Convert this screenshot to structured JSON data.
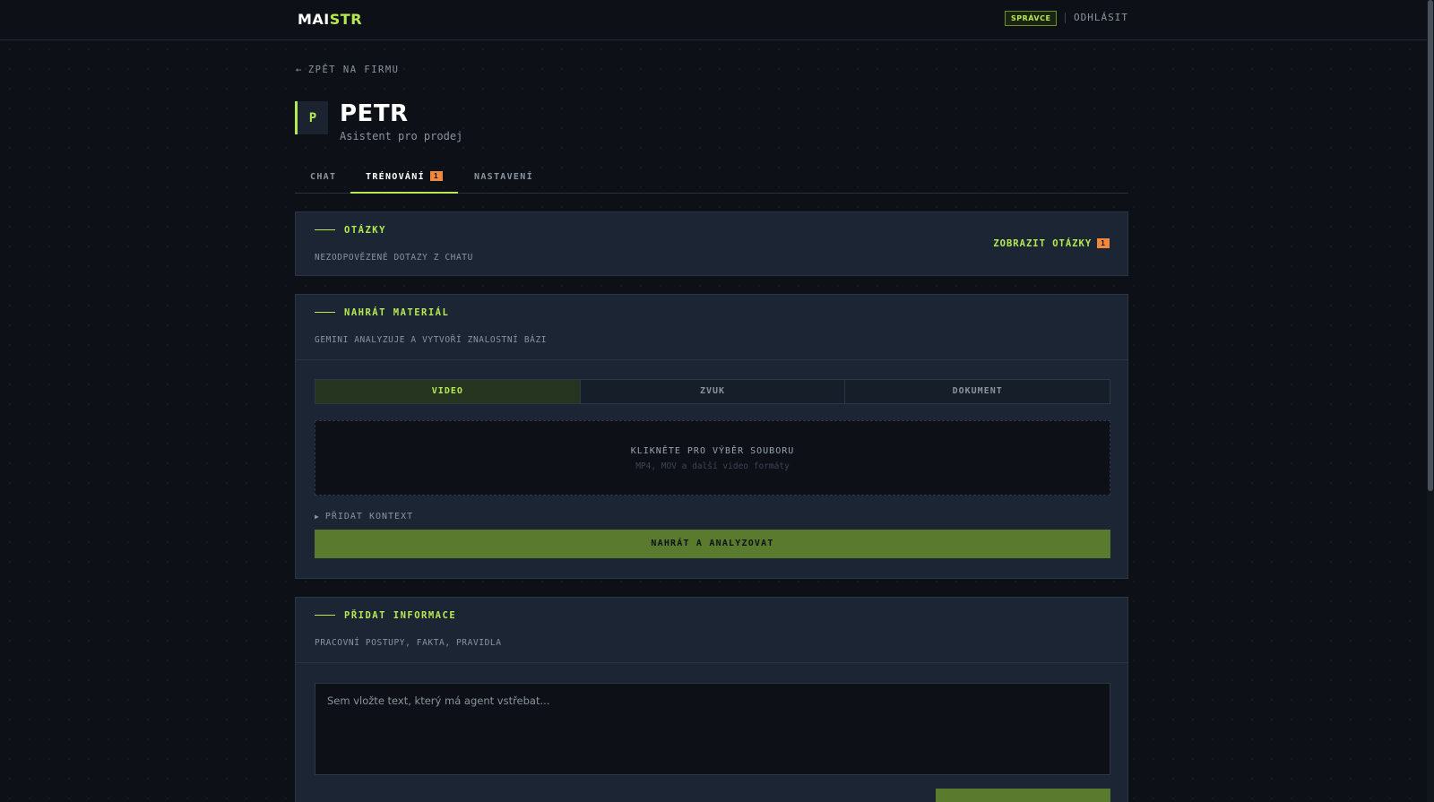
{
  "topbar": {
    "logo_part1": "MAI",
    "logo_part2": "STR",
    "role_badge": "SPRÁVCE",
    "logout": "ODHLÁSIT"
  },
  "nav": {
    "back_arrow": "←",
    "back": "ZPĚT NA FIRMU"
  },
  "agent": {
    "initial": "P",
    "name": "PETR",
    "role": "Asistent pro prodej"
  },
  "tabs": [
    {
      "label": "CHAT"
    },
    {
      "label": "TRÉNOVÁNÍ",
      "badge": "1"
    },
    {
      "label": "NASTAVENÍ"
    }
  ],
  "questions": {
    "title": "OTÁZKY",
    "subtitle": "NEZODPOVĚZENÉ DOTAZY Z CHATU",
    "action": "ZOBRAZIT OTÁZKY",
    "badge": "1"
  },
  "upload": {
    "title": "NAHRÁT MATERIÁL",
    "subtitle": "GEMINI ANALYZUJE A VYTVOŘÍ ZNALOSTNÍ BÁZI",
    "types": [
      "VIDEO",
      "ZVUK",
      "DOKUMENT"
    ],
    "dropzone_main": "KLIKNĚTE PRO VÝBĚR SOUBORU",
    "dropzone_sub": "MP4, MOV a další video formáty",
    "context_toggle_icon": "▶",
    "context_toggle": "PŘIDAT KONTEXT",
    "submit": "NAHRÁT A ANALYZOVAT"
  },
  "info": {
    "title": "PŘIDAT INFORMACE",
    "subtitle": "PRACOVNÍ POSTUPY, FAKTA, PRAVIDLA",
    "placeholder": "Sem vložte text, který má agent vstřebat..."
  },
  "colors": {
    "accent": "#b5e853",
    "badge": "#f0883e",
    "background": "#0d1117",
    "card": "#1b2533",
    "button": "#5a7a2e"
  }
}
